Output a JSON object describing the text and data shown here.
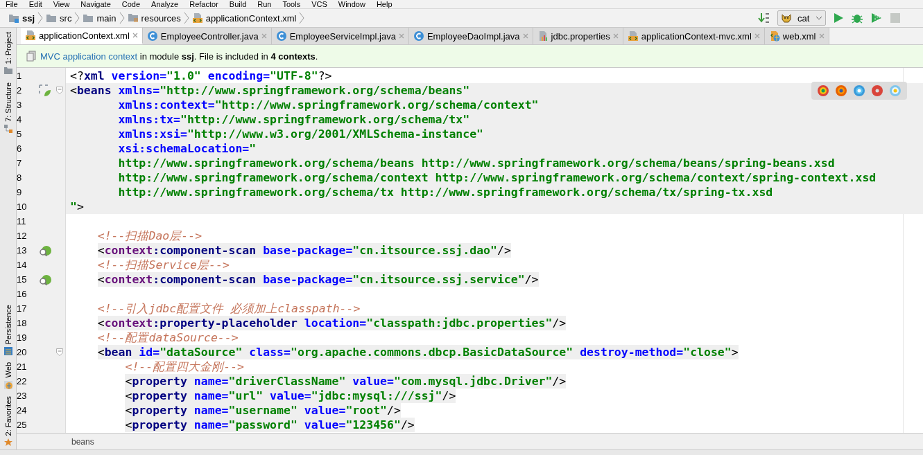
{
  "menu": [
    "File",
    "Edit",
    "View",
    "Navigate",
    "Code",
    "Analyze",
    "Refactor",
    "Build",
    "Run",
    "Tools",
    "VCS",
    "Window",
    "Help"
  ],
  "breadcrumbs": [
    {
      "label": "ssj",
      "kind": "module"
    },
    {
      "label": "src",
      "kind": "folder"
    },
    {
      "label": "main",
      "kind": "folder"
    },
    {
      "label": "resources",
      "kind": "resources"
    },
    {
      "label": "applicationContext.xml",
      "kind": "xml"
    }
  ],
  "run_config": {
    "value": "cat"
  },
  "tool_windows": [
    {
      "label": "1: Project",
      "kind": "project"
    },
    {
      "label": "7: Structure",
      "kind": "structure"
    },
    {
      "label": "Persistence",
      "kind": "persistence"
    },
    {
      "label": "Web",
      "kind": "web"
    },
    {
      "label": "2: Favorites",
      "kind": "favorites"
    }
  ],
  "tabs": [
    {
      "label": "applicationContext.xml",
      "kind": "xml",
      "selected": true
    },
    {
      "label": "EmployeeController.java",
      "kind": "class",
      "selected": false
    },
    {
      "label": "EmployeeServiceImpl.java",
      "kind": "class",
      "selected": false
    },
    {
      "label": "EmployeeDaoImpl.java",
      "kind": "class",
      "selected": false
    },
    {
      "label": "jdbc.properties",
      "kind": "properties",
      "selected": false
    },
    {
      "label": "applicationContext-mvc.xml",
      "kind": "xml",
      "selected": false
    },
    {
      "label": "web.xml",
      "kind": "webxml",
      "selected": false
    }
  ],
  "info_bar": {
    "link": "MVC application context",
    "text": "in module **ssj**. File is included in **4 contexts**."
  },
  "editor": {
    "lines": [
      {
        "number": "1",
        "kind": "plain",
        "fold": false,
        "tokens": [
          {
            "kind": "punct",
            "text": "<?"
          },
          {
            "kind": "tag",
            "text": "xml"
          },
          {
            "kind": "attr",
            "text": " version="
          },
          {
            "kind": "value",
            "text": "\"1.0\""
          },
          {
            "kind": "attr",
            "text": " encoding="
          },
          {
            "kind": "value",
            "text": "\"UTF-8\""
          },
          {
            "kind": "punct",
            "text": "?>"
          }
        ]
      },
      {
        "number": "2",
        "kind": "block",
        "fold": true,
        "tokens": [
          {
            "kind": "punct",
            "text": "<"
          },
          {
            "kind": "tag",
            "text": "beans"
          },
          {
            "kind": "attr",
            "text": " xmlns="
          },
          {
            "kind": "value",
            "text": "\"http://www.springframework.org/schema/beans\""
          }
        ]
      },
      {
        "number": "3",
        "kind": "block",
        "fold": false,
        "tokens": [
          {
            "kind": "attr",
            "text": "       xmlns:context="
          },
          {
            "kind": "value",
            "text": "\"http://www.springframework.org/schema/context\""
          }
        ]
      },
      {
        "number": "4",
        "kind": "block",
        "fold": false,
        "tokens": [
          {
            "kind": "attr",
            "text": "       xmlns:tx="
          },
          {
            "kind": "value",
            "text": "\"http://www.springframework.org/schema/tx\""
          }
        ]
      },
      {
        "number": "5",
        "kind": "block",
        "fold": false,
        "tokens": [
          {
            "kind": "attr",
            "text": "       xmlns:xsi="
          },
          {
            "kind": "value",
            "text": "\"http://www.w3.org/2001/XMLSchema-instance\""
          }
        ]
      },
      {
        "number": "6",
        "kind": "block",
        "fold": false,
        "tokens": [
          {
            "kind": "attr",
            "text": "       xsi:schemaLocation="
          },
          {
            "kind": "value",
            "text": "\""
          }
        ]
      },
      {
        "number": "7",
        "kind": "block",
        "fold": false,
        "tokens": [
          {
            "kind": "value",
            "text": "       http://www.springframework.org/schema/beans http://www.springframework.org/schema/beans/spring-beans.xsd"
          }
        ]
      },
      {
        "number": "8",
        "kind": "block",
        "fold": false,
        "tokens": [
          {
            "kind": "value",
            "text": "       http://www.springframework.org/schema/context http://www.springframework.org/schema/context/spring-context.xsd"
          }
        ]
      },
      {
        "number": "9",
        "kind": "block",
        "fold": false,
        "tokens": [
          {
            "kind": "value",
            "text": "       http://www.springframework.org/schema/tx http://www.springframework.org/schema/tx/spring-tx.xsd"
          }
        ]
      },
      {
        "number": "10",
        "kind": "block",
        "fold": false,
        "tokens": [
          {
            "kind": "value",
            "text": "\""
          },
          {
            "kind": "punct",
            "text": ">"
          }
        ]
      },
      {
        "number": "11",
        "kind": "plain",
        "fold": false
      },
      {
        "number": "12",
        "kind": "plain",
        "fold": false,
        "tokens": [
          {
            "kind": "comment",
            "text": "    <!--扫描Dao层-->"
          }
        ]
      },
      {
        "number": "13",
        "kind": "element",
        "fold": false,
        "tokens": [
          {
            "kind": "punct",
            "text": "    <"
          },
          {
            "kind": "ns",
            "text": "context"
          },
          {
            "kind": "tag",
            "text": ":component-scan"
          },
          {
            "kind": "attr",
            "text": " base-package="
          },
          {
            "kind": "value",
            "text": "\"cn.itsource.ssj.dao\""
          },
          {
            "kind": "punct",
            "text": "/>"
          }
        ]
      },
      {
        "number": "14",
        "kind": "plain",
        "fold": false,
        "tokens": [
          {
            "kind": "comment",
            "text": "    <!--扫描Service层-->"
          }
        ]
      },
      {
        "number": "15",
        "kind": "element",
        "fold": false,
        "tokens": [
          {
            "kind": "punct",
            "text": "    <"
          },
          {
            "kind": "ns",
            "text": "context"
          },
          {
            "kind": "tag",
            "text": ":component-scan"
          },
          {
            "kind": "attr",
            "text": " base-package="
          },
          {
            "kind": "value",
            "text": "\"cn.itsource.ssj.service\""
          },
          {
            "kind": "punct",
            "text": "/>"
          }
        ]
      },
      {
        "number": "16",
        "kind": "plain",
        "fold": false
      },
      {
        "number": "17",
        "kind": "plain",
        "fold": false,
        "tokens": [
          {
            "kind": "comment",
            "text": "    <!--引入jdbc配置文件 必须加上classpath-->"
          }
        ]
      },
      {
        "number": "18",
        "kind": "element",
        "fold": false,
        "tokens": [
          {
            "kind": "punct",
            "text": "    <"
          },
          {
            "kind": "ns",
            "text": "context"
          },
          {
            "kind": "tag",
            "text": ":property-placeholder"
          },
          {
            "kind": "attr",
            "text": " location="
          },
          {
            "kind": "value",
            "text": "\"classpath:jdbc.properties\""
          },
          {
            "kind": "punct",
            "text": "/>"
          }
        ]
      },
      {
        "number": "19",
        "kind": "plain",
        "fold": false,
        "tokens": [
          {
            "kind": "comment",
            "text": "    <!--配置dataSource-->"
          }
        ]
      },
      {
        "number": "20",
        "kind": "element",
        "fold": true,
        "tokens": [
          {
            "kind": "punct",
            "text": "    <"
          },
          {
            "kind": "tag",
            "text": "bean"
          },
          {
            "kind": "attr",
            "text": " id="
          },
          {
            "kind": "value",
            "text": "\"dataSource\""
          },
          {
            "kind": "attr",
            "text": " class="
          },
          {
            "kind": "value",
            "text": "\"org.apache.commons.dbcp.BasicDataSource\""
          },
          {
            "kind": "attr",
            "text": " destroy-method="
          },
          {
            "kind": "value",
            "text": "\"close\""
          },
          {
            "kind": "punct",
            "text": ">"
          }
        ]
      },
      {
        "number": "21",
        "kind": "plain",
        "fold": false,
        "tokens": [
          {
            "kind": "comment",
            "text": "        <!--配置四大金刚-->"
          }
        ]
      },
      {
        "number": "22",
        "kind": "element",
        "fold": false,
        "tokens": [
          {
            "kind": "punct",
            "text": "        <"
          },
          {
            "kind": "tag",
            "text": "property"
          },
          {
            "kind": "attr",
            "text": " name="
          },
          {
            "kind": "value",
            "text": "\"driverClassName\""
          },
          {
            "kind": "attr",
            "text": " value="
          },
          {
            "kind": "value",
            "text": "\"com.mysql.jdbc.Driver\""
          },
          {
            "kind": "punct",
            "text": "/>"
          }
        ]
      },
      {
        "number": "23",
        "kind": "element",
        "fold": false,
        "tokens": [
          {
            "kind": "punct",
            "text": "        <"
          },
          {
            "kind": "tag",
            "text": "property"
          },
          {
            "kind": "attr",
            "text": " name="
          },
          {
            "kind": "value",
            "text": "\"url\""
          },
          {
            "kind": "attr",
            "text": " value="
          },
          {
            "kind": "value",
            "text": "\"jdbc:mysql:///ssj\""
          },
          {
            "kind": "punct",
            "text": "/>"
          }
        ]
      },
      {
        "number": "24",
        "kind": "element",
        "fold": false,
        "tokens": [
          {
            "kind": "punct",
            "text": "        <"
          },
          {
            "kind": "tag",
            "text": "property"
          },
          {
            "kind": "attr",
            "text": " name="
          },
          {
            "kind": "value",
            "text": "\"username\""
          },
          {
            "kind": "attr",
            "text": " value="
          },
          {
            "kind": "value",
            "text": "\"root\""
          },
          {
            "kind": "punct",
            "text": "/>"
          }
        ]
      },
      {
        "number": "25",
        "kind": "element",
        "fold": false,
        "tokens": [
          {
            "kind": "punct",
            "text": "        <"
          },
          {
            "kind": "tag",
            "text": "property"
          },
          {
            "kind": "attr",
            "text": " name="
          },
          {
            "kind": "value",
            "text": "\"password\""
          },
          {
            "kind": "attr",
            "text": " value="
          },
          {
            "kind": "value",
            "text": "\"123456\""
          },
          {
            "kind": "punct",
            "text": "/>"
          }
        ]
      }
    ]
  },
  "footer_breadcrumb": "beans"
}
